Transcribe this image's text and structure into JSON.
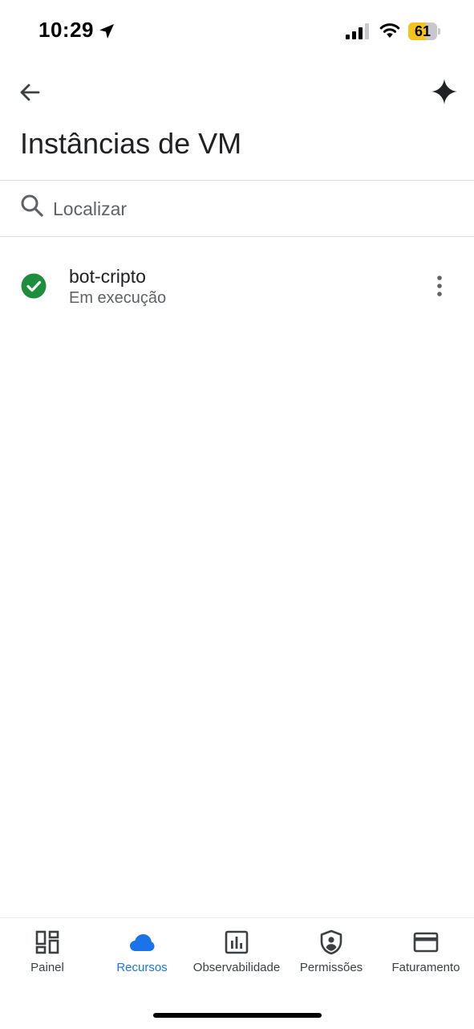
{
  "status_bar": {
    "time": "10:29",
    "battery_level": "61",
    "battery_fraction": 0.61,
    "battery_color": "#f4c41b"
  },
  "header": {
    "title": "Instâncias de VM",
    "back_icon": "arrow-left-icon",
    "assist_icon": "sparkle-icon"
  },
  "search": {
    "placeholder": "Localizar",
    "value": ""
  },
  "instances": [
    {
      "name": "bot-cripto",
      "status": "Em execução",
      "status_icon": "check-circle-icon",
      "status_color": "#1e8e3e"
    }
  ],
  "bottom_nav": {
    "items": [
      {
        "label": "Painel",
        "icon": "dashboard-icon",
        "active": false
      },
      {
        "label": "Recursos",
        "icon": "cloud-icon",
        "active": true
      },
      {
        "label": "Observabilidade",
        "icon": "bar-chart-icon",
        "active": false
      },
      {
        "label": "Permissões",
        "icon": "shield-person-icon",
        "active": false
      },
      {
        "label": "Faturamento",
        "icon": "credit-card-icon",
        "active": false
      }
    ],
    "active_color": "#1a73e8"
  }
}
